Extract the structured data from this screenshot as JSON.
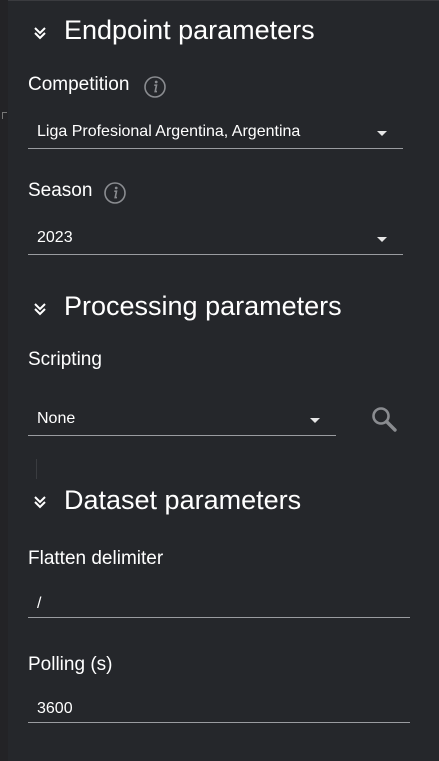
{
  "colors": {
    "background": "#25272b",
    "text": "#ffffff",
    "underline": "#9a9ca0",
    "icon": "#8a8c90"
  },
  "endpoint": {
    "title": "Endpoint parameters",
    "toggle_icon": "double-chevron-down-icon",
    "competition": {
      "label": "Competition",
      "info_icon": "info-icon",
      "value": "Liga Profesional Argentina, Argentina"
    },
    "season": {
      "label": "Season",
      "info_icon": "info-icon",
      "value": "2023"
    }
  },
  "processing": {
    "title": "Processing parameters",
    "toggle_icon": "double-chevron-down-icon",
    "scripting": {
      "label": "Scripting",
      "value": "None",
      "search_icon": "search-icon"
    }
  },
  "dataset": {
    "title": "Dataset parameters",
    "toggle_icon": "double-chevron-down-icon",
    "flatten": {
      "label": "Flatten delimiter",
      "value": "/"
    },
    "polling": {
      "label": "Polling (s)",
      "value": "3600"
    }
  }
}
